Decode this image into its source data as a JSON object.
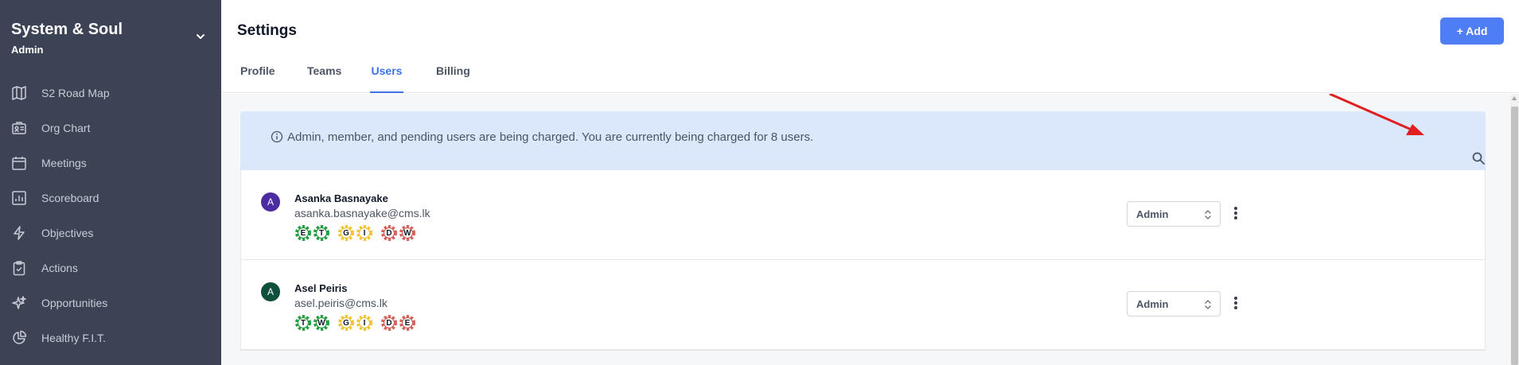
{
  "sidebar": {
    "title": "System & Soul",
    "subtitle": "Admin",
    "items": [
      {
        "label": "S2 Road Map",
        "icon": "map-icon"
      },
      {
        "label": "Org Chart",
        "icon": "org-chart-icon"
      },
      {
        "label": "Meetings",
        "icon": "calendar-icon"
      },
      {
        "label": "Scoreboard",
        "icon": "bar-chart-icon"
      },
      {
        "label": "Objectives",
        "icon": "lightning-icon"
      },
      {
        "label": "Actions",
        "icon": "clipboard-check-icon"
      },
      {
        "label": "Opportunities",
        "icon": "sparkles-icon"
      },
      {
        "label": "Healthy F.I.T.",
        "icon": "pie-chart-icon"
      }
    ]
  },
  "header": {
    "title": "Settings",
    "add_label": "+ Add"
  },
  "tabs": [
    {
      "label": "Profile"
    },
    {
      "label": "Teams"
    },
    {
      "label": "Users",
      "active": true
    },
    {
      "label": "Billing"
    }
  ],
  "banner": {
    "text": "Admin, member, and pending users are being charged. You are currently being charged for 8 users."
  },
  "users": [
    {
      "initial": "A",
      "avatar_color": "#4c2ca3",
      "name": "Asanka Basnayake",
      "email": "asanka.basnayake@cms.lk",
      "badges": [
        [
          "E",
          "T"
        ],
        [
          "G",
          "I"
        ],
        [
          "D",
          "W"
        ]
      ],
      "role": "Admin"
    },
    {
      "initial": "A",
      "avatar_color": "#0f4f3d",
      "name": "Asel Peiris",
      "email": "asel.peiris@cms.lk",
      "badges": [
        [
          "T",
          "W"
        ],
        [
          "G",
          "I"
        ],
        [
          "D",
          "E"
        ]
      ],
      "role": "Admin"
    }
  ],
  "colors": {
    "sidebar_bg": "#3c4354",
    "accent": "#3b73e6",
    "add_button": "#4f7df3",
    "banner_bg": "#dbe8fb",
    "badge_green": "#1e9e3a",
    "badge_yellow": "#f3c230",
    "badge_red": "#d45d55",
    "arrow": "#e02020"
  }
}
